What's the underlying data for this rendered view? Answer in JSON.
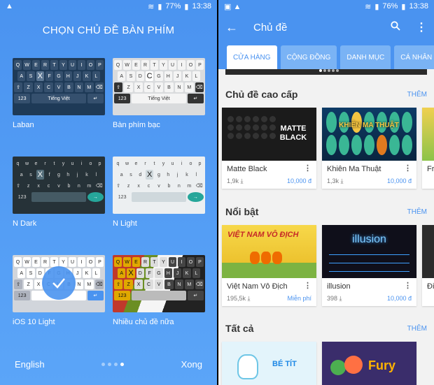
{
  "left": {
    "status": {
      "battery": "77%",
      "time": "13:38"
    },
    "title": "CHỌN CHỦ ĐỀ BÀN PHÍM",
    "themes": [
      {
        "name": "Laban",
        "center_key": "X"
      },
      {
        "name": "Bàn phím bạc",
        "center_key": "C"
      },
      {
        "name": "N Dark",
        "center_key": "X"
      },
      {
        "name": "N Light",
        "center_key": "X"
      },
      {
        "name": "iOS 10 Light",
        "center_key": "X"
      },
      {
        "name": "Nhiều chủ đề nữa",
        "center_key": "X"
      }
    ],
    "kbd_rows": {
      "row1": [
        "Q",
        "W",
        "E",
        "R",
        "T",
        "Y",
        "U",
        "I",
        "O",
        "P"
      ],
      "row1_lower": [
        "q",
        "w",
        "e",
        "r",
        "t",
        "y",
        "u",
        "i",
        "o",
        "p"
      ]
    },
    "space_label": "Tiếng Việt",
    "key_123": "123",
    "bottom": {
      "language": "English",
      "done": "Xong"
    }
  },
  "right": {
    "status": {
      "battery": "76%",
      "time": "13:38"
    },
    "title": "Chủ đề",
    "tabs": [
      "CỬA HÀNG",
      "CỘNG ĐỒNG",
      "DANH MỤC",
      "CÁ NHÂN"
    ],
    "sections": [
      {
        "title": "Chủ đề cao cấp",
        "more": "THÊM",
        "cards": [
          {
            "name": "Matte Black",
            "downloads": "1,9k",
            "price": "10,000 đ",
            "art": "MATTE BLACK"
          },
          {
            "name": "Khiên Ma Thuật",
            "downloads": "1,3k",
            "price": "10,000 đ",
            "art": "KHIÊN MA THUẬT"
          },
          {
            "name": "Fr",
            "downloads": "",
            "price": "",
            "art": ""
          }
        ]
      },
      {
        "title": "Nổi bật",
        "more": "THÊM",
        "cards": [
          {
            "name": "Việt Nam Vô Địch",
            "downloads": "195,5k",
            "price": "Miễn phí",
            "art": "VIỆT NAM VÔ ĐỊCH"
          },
          {
            "name": "illusion",
            "downloads": "398",
            "price": "10,000 đ",
            "art": "illusion"
          },
          {
            "name": "Đi",
            "downloads": "",
            "price": "",
            "art": ""
          }
        ]
      },
      {
        "title": "Tất cả",
        "more": "THÊM",
        "cards": [
          {
            "name": "",
            "art": "BÉ TÍT"
          },
          {
            "name": "",
            "art": "Fury"
          }
        ]
      }
    ]
  }
}
